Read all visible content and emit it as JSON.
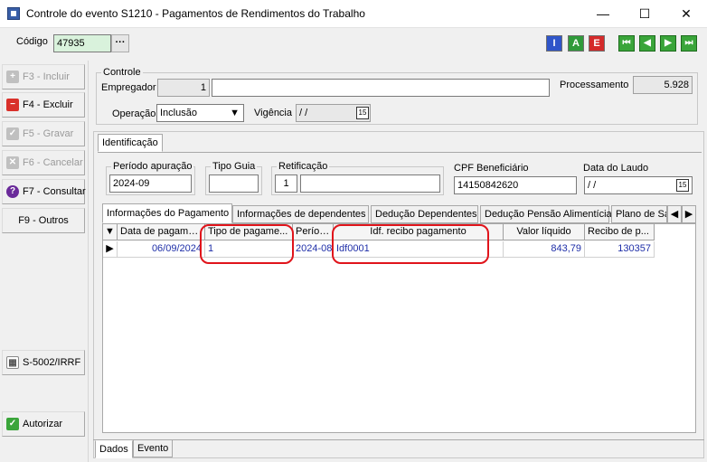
{
  "window": {
    "title": "Controle do evento S1210 - Pagamentos de Rendimentos do Trabalho",
    "minimize": "—",
    "maximize": "☐",
    "close": "✕"
  },
  "header": {
    "codigo_label": "Código",
    "codigo_value": "47935",
    "dots": "···",
    "toolbar_i": "I",
    "toolbar_a": "A",
    "toolbar_e": "E",
    "nav_first": "⏮",
    "nav_prev": "◀",
    "nav_next": "▶",
    "nav_last": "⏭"
  },
  "sidebar": {
    "incluir": "F3 - Incluir",
    "excluir": "F4 - Excluir",
    "gravar": "F5 - Gravar",
    "cancelar": "F6 - Cancelar",
    "consultar": "F7 - Consultar",
    "outros": "F9 - Outros",
    "s5002": "S-5002/IRRF",
    "autorizar": "Autorizar"
  },
  "controle": {
    "title": "Controle",
    "empregador_label": "Empregador",
    "empregador_code": "1",
    "empregador_name": "",
    "processamento_label": "Processamento",
    "processamento_value": "5.928",
    "operacao_label": "Operação",
    "operacao_value": "Inclusão",
    "vigencia_label": "Vigência",
    "vigencia_value": " / /"
  },
  "tabs_top": {
    "identificacao": "Identificação"
  },
  "identificacao": {
    "periodo_label": "Período apuração",
    "periodo_value": "2024-09",
    "tipo_guia_label": "Tipo Guia",
    "tipo_guia_value": "",
    "retificacao_label": "Retificação",
    "retificacao_code": "1",
    "retificacao_value": "",
    "cpf_label": "CPF Beneficiário",
    "cpf_value": "14150842620",
    "laudo_label": "Data do Laudo",
    "laudo_value": " / /"
  },
  "inner_tabs": [
    "Informações do Pagamento",
    "Informações de dependentes",
    "Dedução Dependentes",
    "Dedução Pensão Alimentícia",
    "Plano de Sa"
  ],
  "grid": {
    "columns": [
      "Data de pagame...",
      "Tipo de pagame...",
      "Período",
      "Idf. recibo pagamento",
      "Valor líquido",
      "Recibo de p..."
    ],
    "rows": [
      [
        "06/09/2024",
        "1",
        "2024-08",
        "Idf0001",
        "843,79",
        "130357"
      ]
    ]
  },
  "bottom_tabs": [
    "Dados",
    "Evento"
  ],
  "colors": {
    "highlight": "#e0141b",
    "cell_text": "#1f2fa8"
  }
}
